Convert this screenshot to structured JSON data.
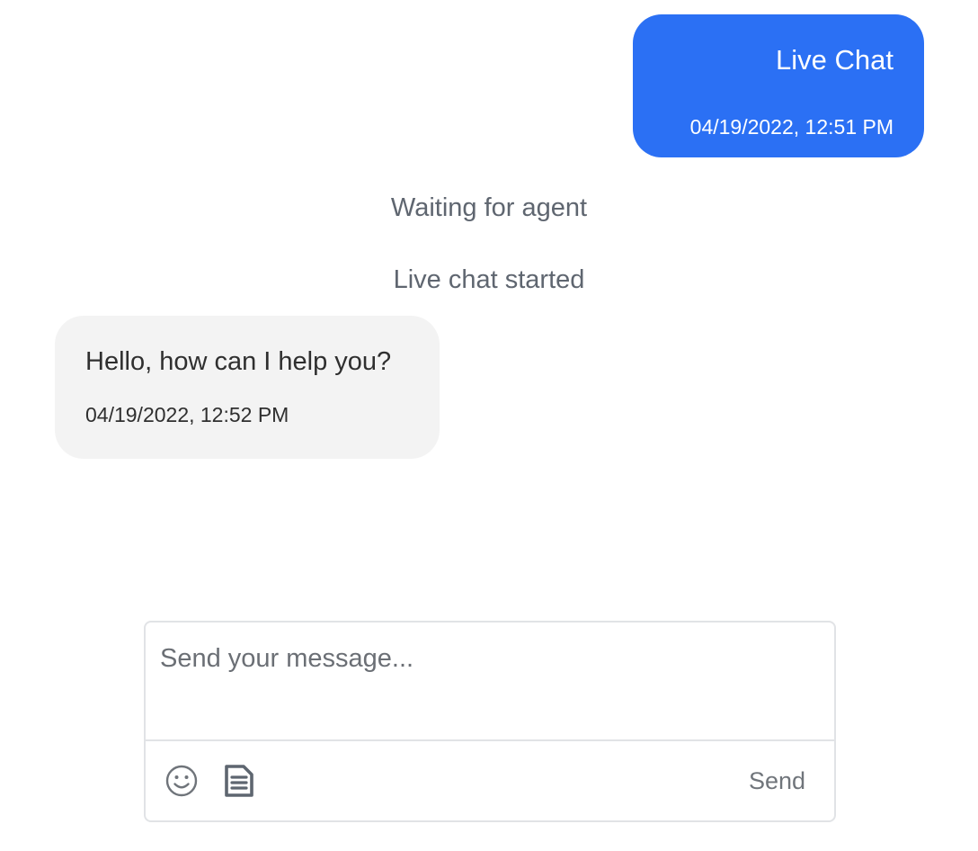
{
  "messages": {
    "outgoing": {
      "text": "Live Chat",
      "time": "04/19/2022, 12:51 PM"
    },
    "system": [
      "Waiting for agent",
      "Live chat started"
    ],
    "incoming": {
      "text": "Hello, how can I help you?",
      "time": "04/19/2022, 12:52 PM"
    }
  },
  "composer": {
    "placeholder": "Send your message...",
    "value": "",
    "send_label": "Send",
    "icons": [
      "emoji-icon",
      "document-icon"
    ]
  },
  "colors": {
    "outgoing_bubble": "#2b70f4",
    "incoming_bubble": "#f3f3f3",
    "system_text": "#5f6670"
  }
}
